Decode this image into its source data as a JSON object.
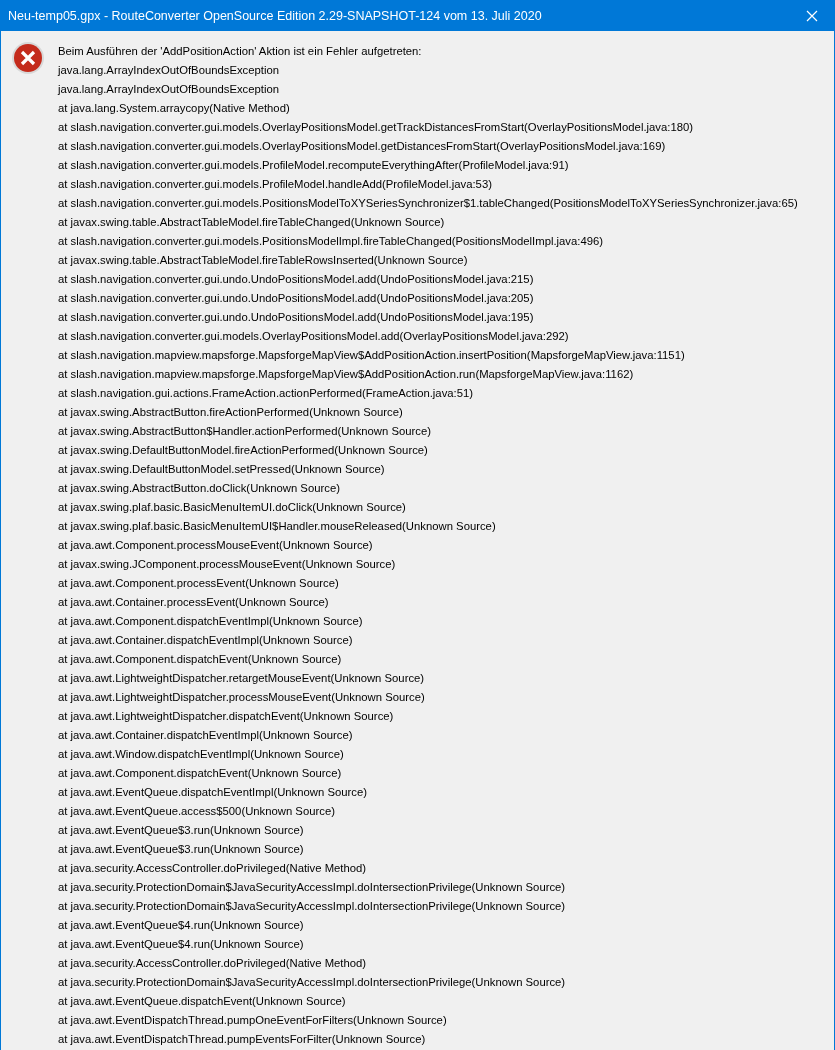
{
  "window": {
    "title": "Neu-temp05.gpx - RouteConverter OpenSource Edition 2.29-SNAPSHOT-124 vom 13. Juli 2020"
  },
  "message": {
    "kind": "error",
    "lines": [
      "Beim Ausführen der 'AddPositionAction' Aktion ist ein Fehler aufgetreten:",
      "java.lang.ArrayIndexOutOfBoundsException",
      "java.lang.ArrayIndexOutOfBoundsException",
      "at java.lang.System.arraycopy(Native Method)",
      "at slash.navigation.converter.gui.models.OverlayPositionsModel.getTrackDistancesFromStart(OverlayPositionsModel.java:180)",
      "at slash.navigation.converter.gui.models.OverlayPositionsModel.getDistancesFromStart(OverlayPositionsModel.java:169)",
      "at slash.navigation.converter.gui.models.ProfileModel.recomputeEverythingAfter(ProfileModel.java:91)",
      "at slash.navigation.converter.gui.models.ProfileModel.handleAdd(ProfileModel.java:53)",
      "at slash.navigation.converter.gui.models.PositionsModelToXYSeriesSynchronizer$1.tableChanged(PositionsModelToXYSeriesSynchronizer.java:65)",
      "at javax.swing.table.AbstractTableModel.fireTableChanged(Unknown Source)",
      "at slash.navigation.converter.gui.models.PositionsModelImpl.fireTableChanged(PositionsModelImpl.java:496)",
      "at javax.swing.table.AbstractTableModel.fireTableRowsInserted(Unknown Source)",
      "at slash.navigation.converter.gui.undo.UndoPositionsModel.add(UndoPositionsModel.java:215)",
      "at slash.navigation.converter.gui.undo.UndoPositionsModel.add(UndoPositionsModel.java:205)",
      "at slash.navigation.converter.gui.undo.UndoPositionsModel.add(UndoPositionsModel.java:195)",
      "at slash.navigation.converter.gui.models.OverlayPositionsModel.add(OverlayPositionsModel.java:292)",
      "at slash.navigation.mapview.mapsforge.MapsforgeMapView$AddPositionAction.insertPosition(MapsforgeMapView.java:1151)",
      "at slash.navigation.mapview.mapsforge.MapsforgeMapView$AddPositionAction.run(MapsforgeMapView.java:1162)",
      "at slash.navigation.gui.actions.FrameAction.actionPerformed(FrameAction.java:51)",
      "at javax.swing.AbstractButton.fireActionPerformed(Unknown Source)",
      "at javax.swing.AbstractButton$Handler.actionPerformed(Unknown Source)",
      "at javax.swing.DefaultButtonModel.fireActionPerformed(Unknown Source)",
      "at javax.swing.DefaultButtonModel.setPressed(Unknown Source)",
      "at javax.swing.AbstractButton.doClick(Unknown Source)",
      "at javax.swing.plaf.basic.BasicMenuItemUI.doClick(Unknown Source)",
      "at javax.swing.plaf.basic.BasicMenuItemUI$Handler.mouseReleased(Unknown Source)",
      "at java.awt.Component.processMouseEvent(Unknown Source)",
      "at javax.swing.JComponent.processMouseEvent(Unknown Source)",
      "at java.awt.Component.processEvent(Unknown Source)",
      "at java.awt.Container.processEvent(Unknown Source)",
      "at java.awt.Component.dispatchEventImpl(Unknown Source)",
      "at java.awt.Container.dispatchEventImpl(Unknown Source)",
      "at java.awt.Component.dispatchEvent(Unknown Source)",
      "at java.awt.LightweightDispatcher.retargetMouseEvent(Unknown Source)",
      "at java.awt.LightweightDispatcher.processMouseEvent(Unknown Source)",
      "at java.awt.LightweightDispatcher.dispatchEvent(Unknown Source)",
      "at java.awt.Container.dispatchEventImpl(Unknown Source)",
      "at java.awt.Window.dispatchEventImpl(Unknown Source)",
      "at java.awt.Component.dispatchEvent(Unknown Source)",
      "at java.awt.EventQueue.dispatchEventImpl(Unknown Source)",
      "at java.awt.EventQueue.access$500(Unknown Source)",
      "at java.awt.EventQueue$3.run(Unknown Source)",
      "at java.awt.EventQueue$3.run(Unknown Source)",
      "at java.security.AccessController.doPrivileged(Native Method)",
      "at java.security.ProtectionDomain$JavaSecurityAccessImpl.doIntersectionPrivilege(Unknown Source)",
      "at java.security.ProtectionDomain$JavaSecurityAccessImpl.doIntersectionPrivilege(Unknown Source)",
      "at java.awt.EventQueue$4.run(Unknown Source)",
      "at java.awt.EventQueue$4.run(Unknown Source)",
      "at java.security.AccessController.doPrivileged(Native Method)",
      "at java.security.ProtectionDomain$JavaSecurityAccessImpl.doIntersectionPrivilege(Unknown Source)",
      "at java.awt.EventQueue.dispatchEvent(Unknown Source)",
      "at java.awt.EventDispatchThread.pumpOneEventForFilters(Unknown Source)",
      "at java.awt.EventDispatchThread.pumpEventsForFilter(Unknown Source)"
    ]
  }
}
